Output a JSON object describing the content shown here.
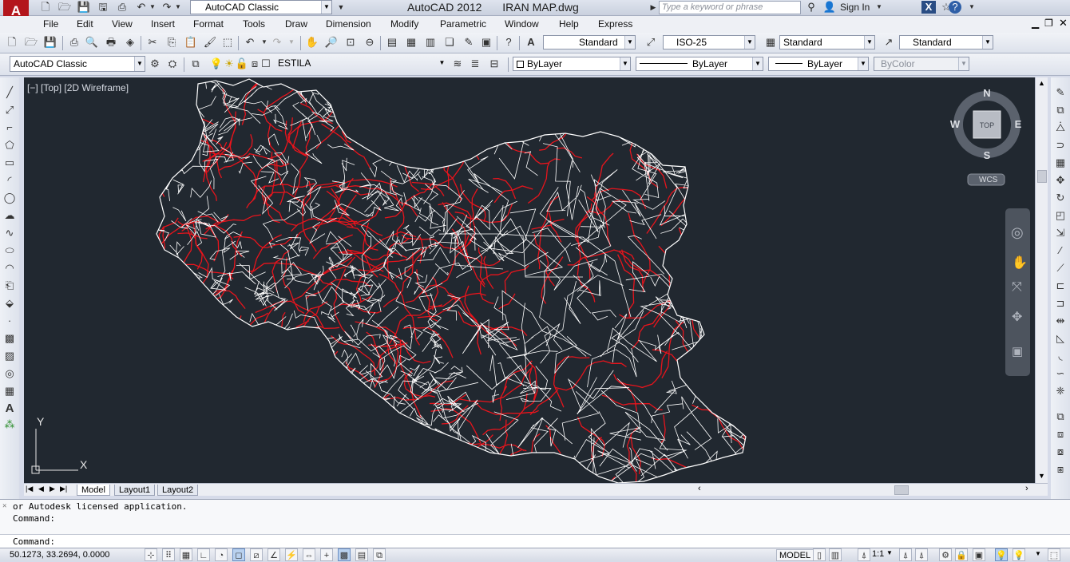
{
  "title": {
    "app_name": "AutoCAD 2012",
    "file_name": "IRAN MAP.dwg",
    "workspace": "AutoCAD Classic",
    "search_placeholder": "Type a keyword or phrase",
    "sign_in": "Sign In"
  },
  "menu": [
    "File",
    "Edit",
    "View",
    "Insert",
    "Format",
    "Tools",
    "Draw",
    "Dimension",
    "Modify",
    "Parametric",
    "Window",
    "Help",
    "Express"
  ],
  "styles_toolbar": {
    "text_style": "Standard",
    "dim_style": "ISO-25",
    "table_style": "Standard",
    "mleader_style": "Standard"
  },
  "layers_toolbar": {
    "workspace": "AutoCAD Classic",
    "layer": "ESTILA",
    "color": "ByLayer",
    "linetype": "ByLayer",
    "lineweight": "ByLayer",
    "plotstyle": "ByColor"
  },
  "viewport": {
    "label": "[−] [Top] [2D Wireframe]",
    "compass": {
      "n": "N",
      "s": "S",
      "e": "E",
      "w": "W",
      "cube": "TOP"
    },
    "wcs": "WCS",
    "ucs_x": "X",
    "ucs_y": "Y"
  },
  "colors": {
    "background": "#212830",
    "boundaries": "#ffffff",
    "roads": "#e8141c"
  },
  "tabs": [
    "Model",
    "Layout1",
    "Layout2"
  ],
  "command": {
    "line1": "or Autodesk licensed application.",
    "line2": "Command:",
    "prompt": "Command:"
  },
  "status": {
    "coords": "50.1273, 33.2694, 0.0000",
    "model": "MODEL",
    "annotation_scale": "1:1"
  }
}
